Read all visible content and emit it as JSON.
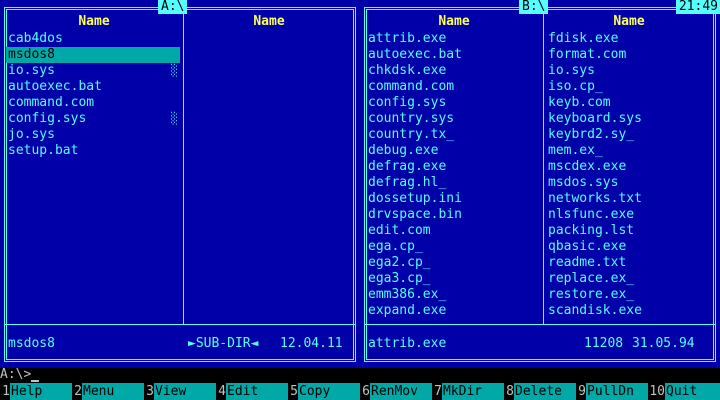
{
  "left_panel": {
    "path": "A:\\",
    "col1_header": "Name",
    "col2_header": "Name",
    "files": [
      "cab4dos",
      "msdos8",
      "io.sys",
      "autoexec.bat",
      "command.com",
      "config.sys",
      "jo.sys",
      "setup.bat"
    ],
    "selected_index": 1,
    "info_name": "msdos8",
    "info_type": "►SUB-DIR◄",
    "info_date": "12.04.11"
  },
  "right_panel": {
    "path": "B:\\",
    "col1_header": "Name",
    "col2_header": "Name",
    "col1_files": [
      "attrib.exe",
      "autoexec.bat",
      "chkdsk.exe",
      "command.com",
      "config.sys",
      "country.sys",
      "country.tx_",
      "debug.exe",
      "defrag.exe",
      "defrag.hl_",
      "dossetup.ini",
      "drvspace.bin",
      "edit.com",
      "ega.cp_",
      "ega2.cp_",
      "ega3.cp_",
      "emm386.ex_",
      "expand.exe"
    ],
    "col2_files": [
      "fdisk.exe",
      "format.com",
      "io.sys",
      "iso.cp_",
      "keyb.com",
      "keyboard.sys",
      "keybrd2.sy_",
      "mem.ex_",
      "mscdex.exe",
      "msdos.sys",
      "networks.txt",
      "nlsfunc.exe",
      "packing.lst",
      "qbasic.exe",
      "readme.txt",
      "replace.ex_",
      "restore.ex_",
      "scandisk.exe"
    ],
    "info_name": "attrib.exe",
    "info_size": "11208",
    "info_date": "31.05.94"
  },
  "clock": "21:49",
  "command_prompt": "A:\\>",
  "function_keys": [
    {
      "num": "1",
      "label": "Help"
    },
    {
      "num": "2",
      "label": "Menu"
    },
    {
      "num": "3",
      "label": "View"
    },
    {
      "num": "4",
      "label": "Edit"
    },
    {
      "num": "5",
      "label": "Copy"
    },
    {
      "num": "6",
      "label": "RenMov"
    },
    {
      "num": "7",
      "label": "MkDir"
    },
    {
      "num": "8",
      "label": "Delete"
    },
    {
      "num": "9",
      "label": "PullDn"
    },
    {
      "num": "10",
      "label": "Quit"
    }
  ],
  "colors": {
    "panel_bg": "#0000a8",
    "text_cyan": "#55ffff",
    "header_yellow": "#ffff55",
    "selection_bg": "#00a8a8",
    "fkey_bg": "#00a8a8"
  }
}
